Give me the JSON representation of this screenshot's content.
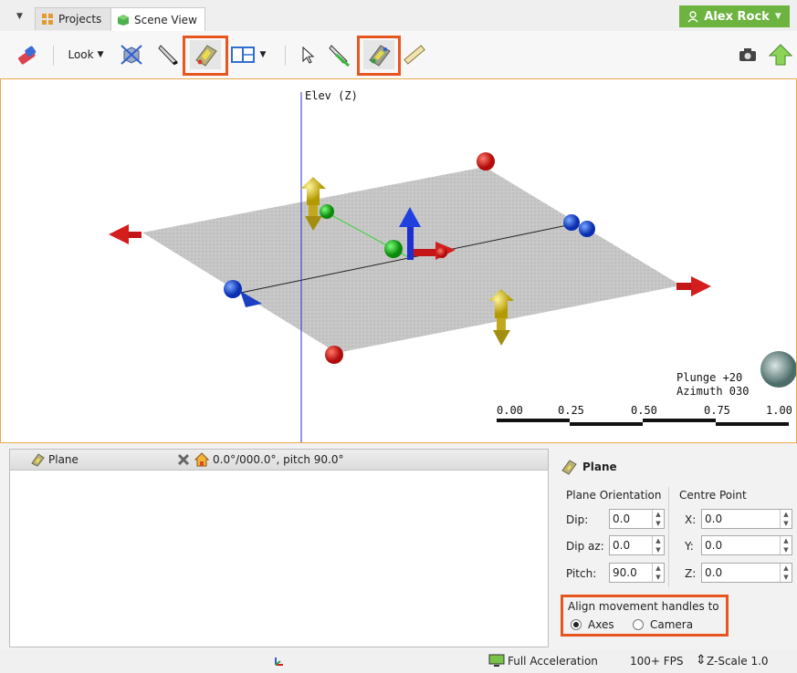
{
  "tabs": [
    {
      "label": "Projects",
      "icon": "projects-grid-icon"
    },
    {
      "label": "Scene View",
      "icon": "scene-cube-icon"
    }
  ],
  "user": {
    "name": "Alex Rock",
    "icon": "person-icon"
  },
  "toolbar": {
    "look_label": "Look",
    "tools": [
      "eraser-icon",
      "look-dropdown",
      "cube-axes-icon",
      "slice-knife-icon",
      "plane-move-icon",
      "split-view-icon",
      "pointer-icon",
      "draw-line-icon",
      "plane-handle-icon",
      "ruler-icon",
      "camera-icon",
      "upload-arrow-icon"
    ],
    "highlight_color": "#e8561f"
  },
  "scene": {
    "axis_label": "Elev (Z)",
    "orientation": {
      "plunge": "Plunge +20",
      "azimuth": "Azimuth 030"
    },
    "scale_labels": [
      "0.00",
      "0.25",
      "0.50",
      "0.75",
      "1.00"
    ]
  },
  "object_panel": {
    "item_label": "Plane",
    "orientation_text": "0.0°/000.0°, pitch 90.0°"
  },
  "properties": {
    "title": "Plane",
    "orientation_heading": "Plane Orientation",
    "centre_heading": "Centre Point",
    "dip": {
      "label": "Dip:",
      "value": "0.0"
    },
    "dip_az": {
      "label": "Dip az:",
      "value": "0.0"
    },
    "pitch": {
      "label": "Pitch:",
      "value": "90.0"
    },
    "x": {
      "label": "X:",
      "value": "0.0"
    },
    "y": {
      "label": "Y:",
      "value": "0.0"
    },
    "z": {
      "label": "Z:",
      "value": "0.0"
    },
    "align_label": "Align movement handles to",
    "align_options": [
      "Axes",
      "Camera"
    ],
    "align_selected": "Axes"
  },
  "status": {
    "acceleration": "Full Acceleration",
    "fps": "100+ FPS",
    "zscale": "Z-Scale 1.0"
  }
}
